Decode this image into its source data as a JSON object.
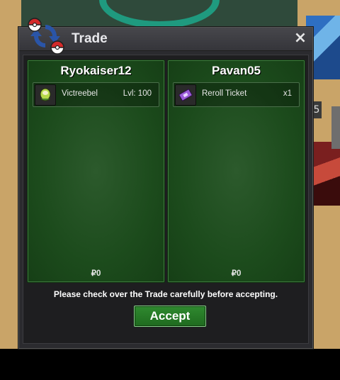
{
  "window": {
    "title": "Trade",
    "close_label": "×"
  },
  "trade": {
    "left": {
      "player": "Ryokaiser12",
      "item": {
        "name": "Victreebel",
        "meta": "Lvl: 100",
        "icon": "victreebel-sprite-icon"
      },
      "money": "₽0"
    },
    "right": {
      "player": "Pavan05",
      "item": {
        "name": "Reroll Ticket",
        "meta": "x1",
        "icon": "ticket-icon"
      },
      "money": "₽0"
    }
  },
  "notice": "Please check over the Trade carefully before accepting.",
  "accept_label": "Accept",
  "background": {
    "side_number": "5"
  },
  "colors": {
    "panel_green": "#1f4f1f",
    "accept_green": "#2a7a2a"
  }
}
